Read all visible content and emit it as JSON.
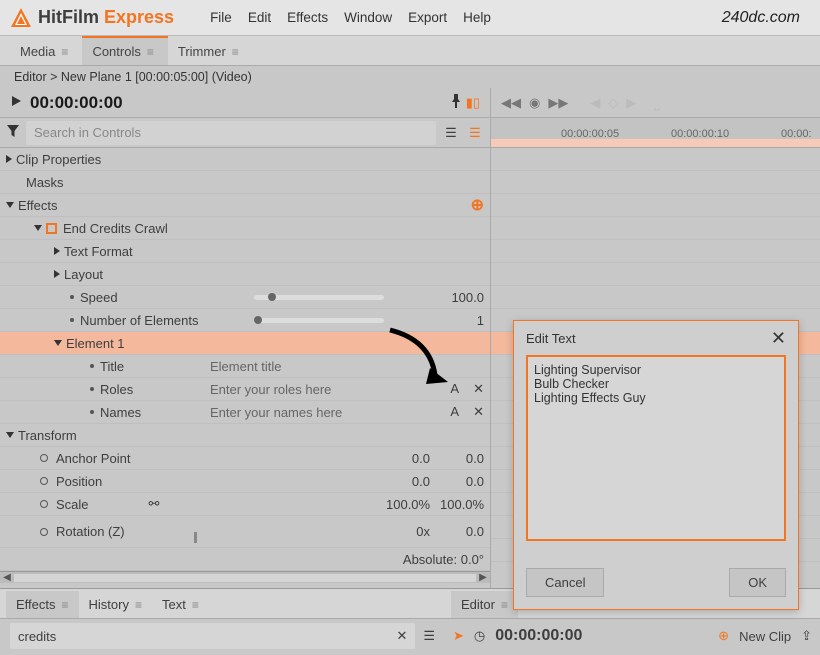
{
  "app": {
    "name1": "HitFilm ",
    "name2": "Express"
  },
  "menu": [
    "File",
    "Edit",
    "Effects",
    "Window",
    "Export",
    "Help"
  ],
  "watermark": "240dc.com",
  "tabs": {
    "media": "Media",
    "controls": "Controls",
    "trimmer": "Trimmer"
  },
  "breadcrumb": "Editor > New Plane 1 [00:00:05:00] (Video)",
  "timecode": "00:00:00:00",
  "search": {
    "placeholder": "Search in Controls"
  },
  "ruler": {
    "m1": "00:00:00:05",
    "m2": "00:00:00:10",
    "m3": "00:00:"
  },
  "props": {
    "clip": "Clip Properties",
    "masks": "Masks",
    "effects": "Effects",
    "endcredits": "End Credits Crawl",
    "textformat": "Text Format",
    "layout": "Layout",
    "speed": "Speed",
    "speed_val": "100.0",
    "numel": "Number of Elements",
    "numel_val": "1",
    "element1": "Element 1",
    "title": "Title",
    "title_val": "Element title",
    "roles": "Roles",
    "roles_val": "Enter your roles here",
    "names": "Names",
    "names_val": "Enter your names here",
    "transform": "Transform",
    "anchor": "Anchor Point",
    "anchor_x": "0.0",
    "anchor_y": "0.0",
    "position": "Position",
    "pos_x": "0.0",
    "pos_y": "0.0",
    "scale": "Scale",
    "scale_x": "100.0%",
    "scale_y": "100.0%",
    "rotation": "Rotation (Z)",
    "rot_val": "0x",
    "rot_deg": "0.0",
    "absolute": "Absolute: 0.0°",
    "a_btn": "A",
    "x_btn": "✕"
  },
  "bottom": {
    "effects": "Effects",
    "history": "History",
    "text": "Text",
    "editor": "Editor",
    "search_val": "credits",
    "editor_time": "00:00:00:00",
    "newclip": "New Clip"
  },
  "dialog": {
    "title": "Edit Text",
    "text": "Lighting Supervisor\nBulb Checker\nLighting Effects Guy",
    "cancel": "Cancel",
    "ok": "OK"
  }
}
